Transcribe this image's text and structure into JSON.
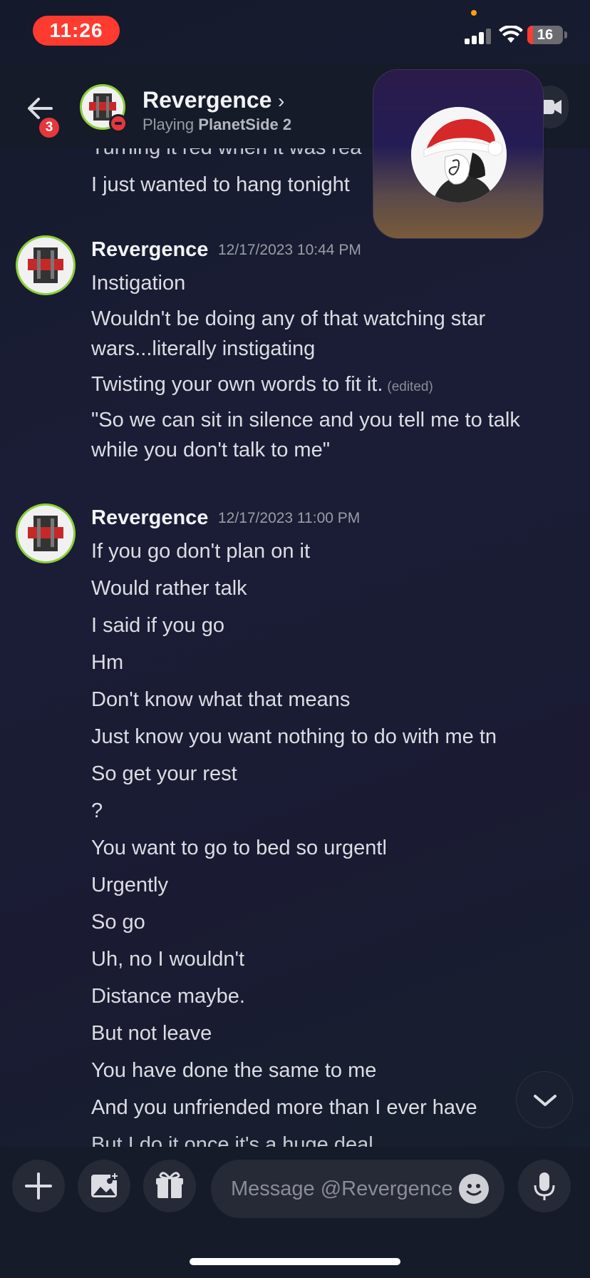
{
  "status_bar": {
    "time": "11:26",
    "battery": "16",
    "battery_fraction": 0.16
  },
  "header": {
    "back_badge": "3",
    "name": "Revergence",
    "activity_prefix": "Playing",
    "activity_game": "PlanetSide 2"
  },
  "messages": {
    "partial_top": {
      "line_cut": "Turning it red when it was rea",
      "line": "I just wanted to hang tonight"
    },
    "groups": [
      {
        "author": "Revergence",
        "timestamp": "12/17/2023 10:44 PM",
        "lines": [
          "Instigation",
          "Wouldn't be doing any of that watching star",
          "wars...literally instigating",
          "Twisting your own words to fit it.",
          "\"So we can sit in silence and you tell me to talk",
          "while you don't talk to me\""
        ],
        "edited_label": "(edited)"
      },
      {
        "author": "Revergence",
        "timestamp": "12/17/2023 11:00 PM",
        "lines": [
          "If you go don't plan on it",
          "Would rather talk",
          "I said if you go",
          "Hm",
          "Don't know what that means",
          "Just know you want nothing to do with me tn",
          "So get your rest",
          "?",
          "You want to go to bed so urgentl",
          "Urgently",
          "So go",
          "Uh, no I wouldn't",
          "Distance maybe.",
          "But not leave",
          "You have done the same to me",
          "And you unfriended more than I ever have",
          "But I do it once it's a huge deal"
        ]
      }
    ]
  },
  "composer": {
    "placeholder": "Message @Revergence"
  },
  "icons": {
    "back": "arrow-left-icon",
    "video": "video-camera-icon",
    "scroll": "chevron-down-icon",
    "add": "plus-icon",
    "image": "image-icon",
    "gift": "gift-icon",
    "emoji": "emoji-icon",
    "mic": "microphone-icon"
  },
  "colors": {
    "accent_red": "#ff3b30",
    "dnd_red": "#e5383b",
    "avatar_ring": "#8ccf3a"
  }
}
